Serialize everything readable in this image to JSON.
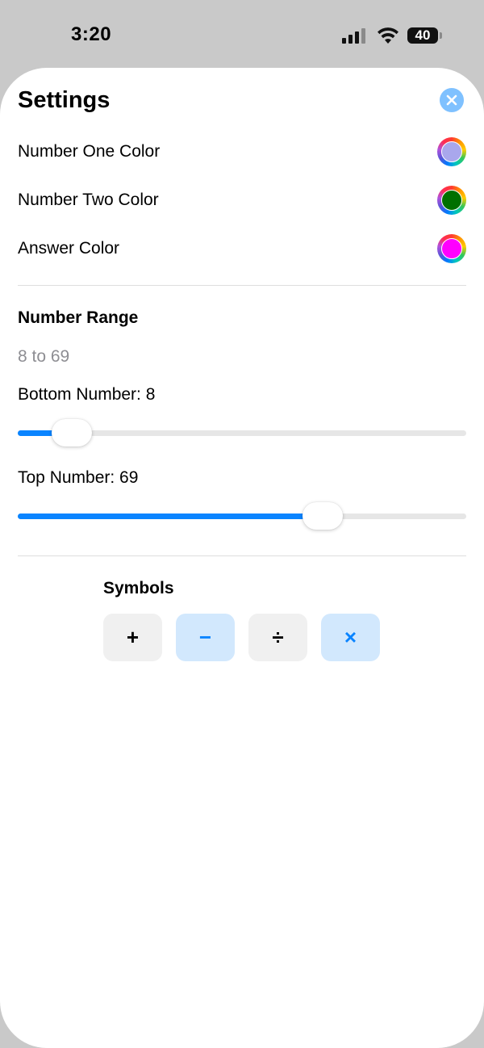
{
  "status_bar": {
    "time": "3:20",
    "battery": "40"
  },
  "settings": {
    "title": "Settings",
    "colors": [
      {
        "label": "Number One Color",
        "color": "#a9a7ec"
      },
      {
        "label": "Number Two Color",
        "color": "#007000"
      },
      {
        "label": "Answer Color",
        "color": "#ff00ff"
      }
    ],
    "range": {
      "title": "Number Range",
      "summary": "8 to 69",
      "bottom": {
        "label": "Bottom Number: 8",
        "fraction": 0.12
      },
      "top": {
        "label": "Top Number: 69",
        "fraction": 0.68
      }
    },
    "symbols": {
      "title": "Symbols",
      "items": [
        {
          "symbol": "+",
          "selected": false
        },
        {
          "symbol": "−",
          "selected": true
        },
        {
          "symbol": "÷",
          "selected": false
        },
        {
          "symbol": "×",
          "selected": true
        }
      ]
    }
  },
  "colors": {
    "accent": "#0a84ff",
    "close_button": "#7fc1ff"
  },
  "icons": {
    "close": "close-icon",
    "signal": "cellular-signal-icon",
    "wifi": "wifi-icon",
    "battery": "battery-icon"
  }
}
